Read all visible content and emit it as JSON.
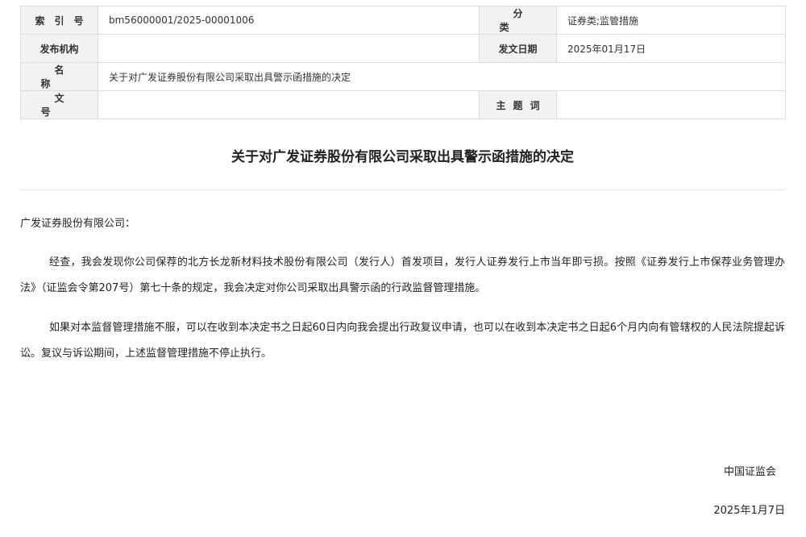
{
  "meta": {
    "index_label": "索引号",
    "index_value": "bm56000001/2025-00001006",
    "category_label": "分类",
    "category_value": "证券类;监管措施",
    "issuer_label": "发布机构",
    "issuer_value": "",
    "date_label": "发文日期",
    "date_value": "2025年01月17日",
    "name_label": "名称",
    "name_value": "关于对广发证券股份有限公司采取出具警示函措施的决定",
    "docno_label": "文号",
    "docno_value": "",
    "subject_label": "主题词",
    "subject_value": ""
  },
  "document": {
    "title": "关于对广发证券股份有限公司采取出具警示函措施的决定",
    "addressee": "广发证券股份有限公司：",
    "paragraphs": [
      "经查，我会发现你公司保荐的北方长龙新材料技术股份有限公司（发行人）首发项目，发行人证券发行上市当年即亏损。按照《证券发行上市保荐业务管理办法》（证监会令第207号）第七十条的规定，我会决定对你公司采取出具警示函的行政监督管理措施。",
      "如果对本监督管理措施不服，可以在收到本决定书之日起60日内向我会提出行政复议申请，也可以在收到本决定书之日起6个月内向有管辖权的人民法院提起诉讼。复议与诉讼期间，上述监督管理措施不停止执行。"
    ],
    "signature_org": "中国证监会",
    "signature_date": "2025年1月7日"
  }
}
